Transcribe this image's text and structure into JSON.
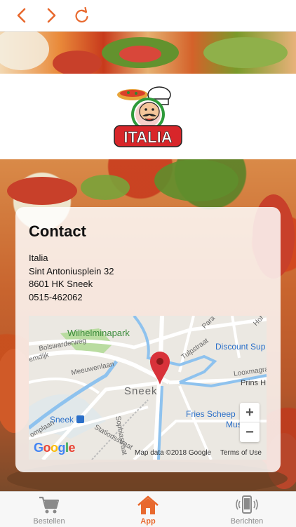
{
  "colors": {
    "accent": "#e8692e",
    "tab_inactive": "#8a8a8a",
    "text": "#111111",
    "map_link": "#2a6fc9"
  },
  "toolbar": {
    "back_icon": "chevron-left-icon",
    "forward_icon": "chevron-right-icon",
    "reload_icon": "reload-icon"
  },
  "logo": {
    "text": "ITALIA",
    "mark": "Pizza"
  },
  "contact": {
    "title": "Contact",
    "name": "Italia",
    "street": "Sint Antoniusplein 32",
    "city": "8601 HK Sneek",
    "phone": "0515-462062"
  },
  "map": {
    "labels": {
      "park": "Wilhelminapark",
      "bolsward": "Bolswarderweg",
      "meeuwen": "Meeuwenlaan",
      "dijk": "emdijk",
      "tulp": "Tulpstraat",
      "para": "Para",
      "hof": "Hof",
      "discount": "Discount Sup",
      "loox": "Looxmagraa",
      "prins": "Prins H",
      "city": "Sneek",
      "sophia": "Sophiastraat",
      "station_label": "Sneek",
      "fries": "Fries Scheep",
      "mus": "Mus",
      "complaan": "omplaan",
      "stations": "Stationsstraat"
    },
    "google_logo": "Google",
    "attribution": "Map data ©2018 Google",
    "terms": "Terms of Use",
    "zoom_in": "+",
    "zoom_out": "−"
  },
  "tabs": [
    {
      "label": "Bestellen",
      "icon": "cart-icon",
      "active": false
    },
    {
      "label": "App",
      "icon": "home-icon",
      "active": true
    },
    {
      "label": "Berichten",
      "icon": "phone-vibrate-icon",
      "active": false
    }
  ]
}
